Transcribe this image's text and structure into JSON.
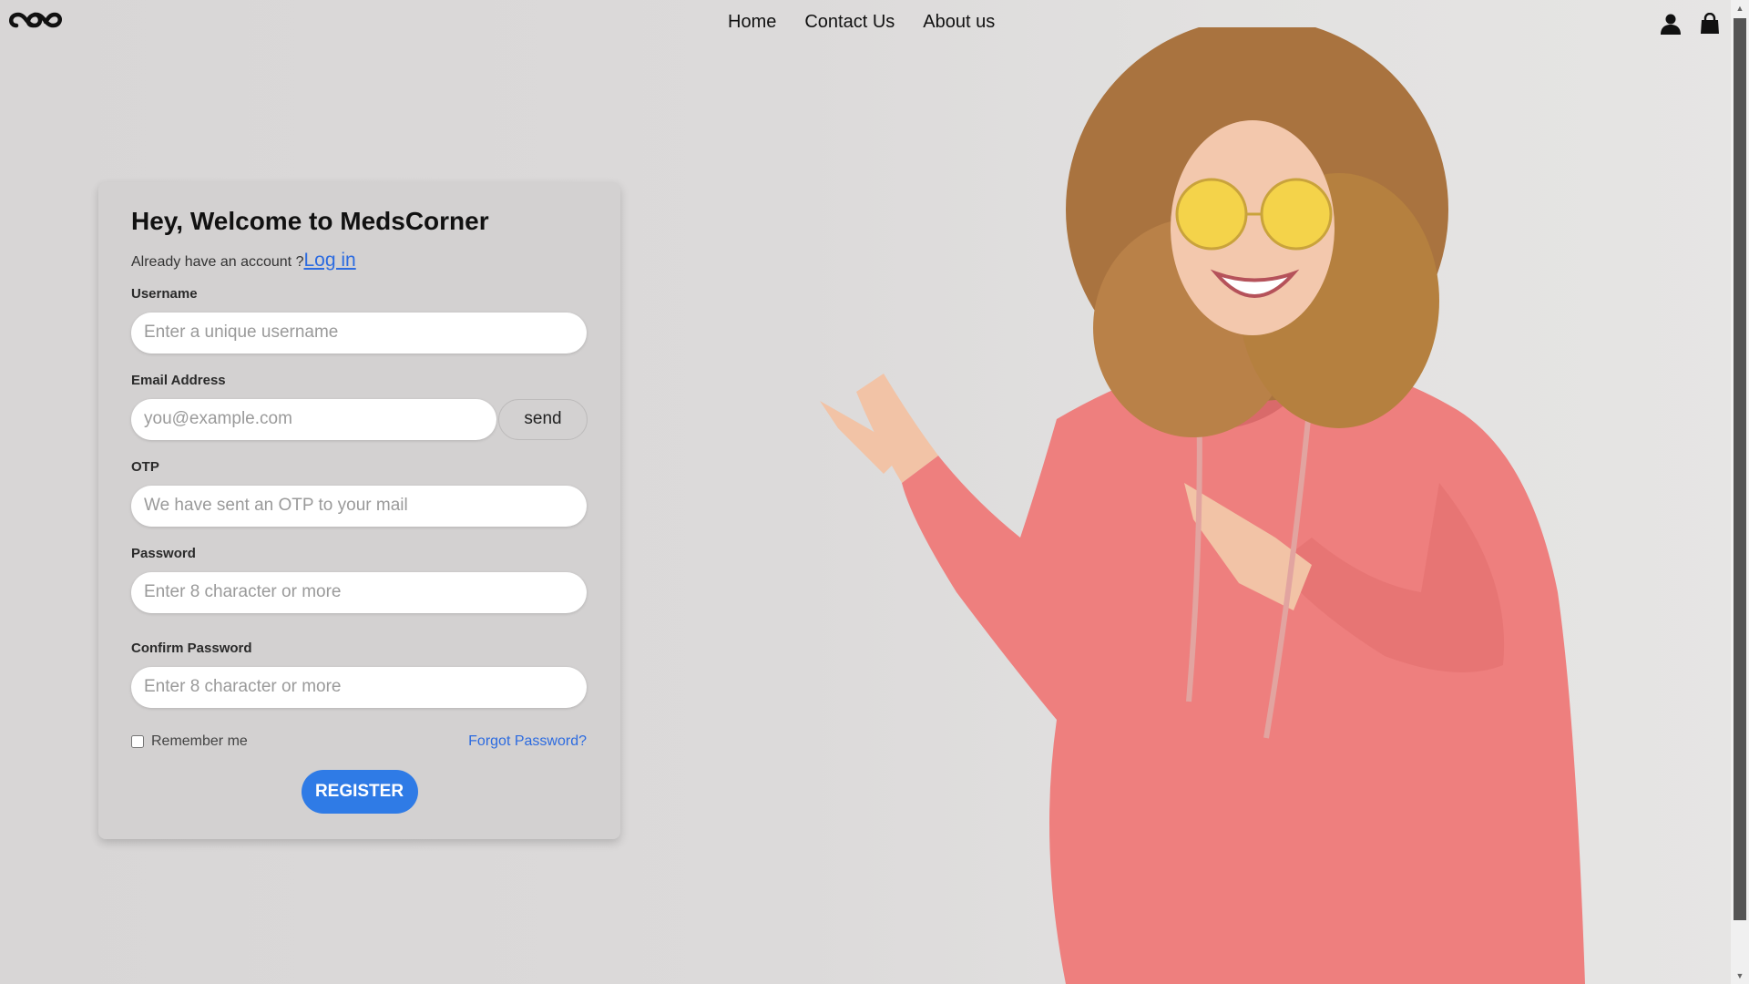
{
  "header": {
    "logo_name": "infinity-logo",
    "nav": [
      "Home",
      "Contact Us",
      "About us"
    ],
    "icons": [
      "user-icon",
      "bag-icon"
    ]
  },
  "form": {
    "title": "Hey, Welcome to MedsCorner",
    "already_text": "Already have an account ?",
    "login_link": "Log in",
    "username_label": "Username",
    "username_placeholder": "Enter a unique username",
    "email_label": "Email Address",
    "email_placeholder": "you@example.com",
    "send_label": "send",
    "otp_label": "OTP",
    "otp_placeholder": "We have sent an OTP to your mail",
    "password_label": "Password",
    "password_placeholder": "Enter 8 character or more",
    "confirm_label": "Confirm Password",
    "confirm_placeholder": "Enter 8 character or more",
    "remember_label": "Remember me",
    "remember_checked": false,
    "forgot_label": "Forgot Password?",
    "register_label": "REGISTER"
  },
  "colors": {
    "accent": "#2f7be6",
    "link": "#2c6be0",
    "hoodie": "#ee7f7e"
  }
}
